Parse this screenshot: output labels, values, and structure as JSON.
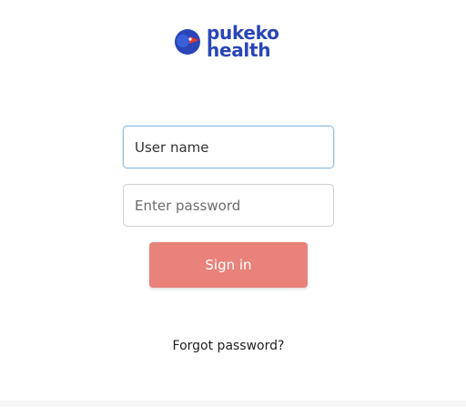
{
  "brand": {
    "line1": "pukeko",
    "line2": "health",
    "color": "#2a45b8",
    "logo_icon": "pukeko-bird-logo"
  },
  "login": {
    "username_value": "User name",
    "password_placeholder": "Enter password",
    "signin_label": "Sign in",
    "signin_color": "#e8827a",
    "forgot_label": "Forgot password?"
  }
}
